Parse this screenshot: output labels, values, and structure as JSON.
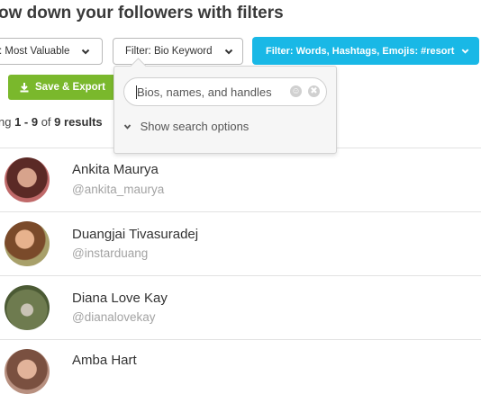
{
  "page": {
    "heading": "ow down your followers with filters"
  },
  "toolbar": {
    "sort_label": ": Most Valuable",
    "bio_filter_label": "Filter: Bio Keyword",
    "words_filter_label": "Filter: Words, Hashtags, Emojis: #resort",
    "save_label": "Save & Export"
  },
  "results": {
    "prefix": "ng ",
    "range": "1 - 9",
    "of": " of ",
    "total": "9 results"
  },
  "popup": {
    "search_placeholder": "Bios, names, and handles",
    "options_label": "Show search options"
  },
  "users": [
    {
      "name": "Ankita Maurya",
      "handle": "@ankita_maurya"
    },
    {
      "name": "Duangjai Tivasuradej",
      "handle": "@instarduang"
    },
    {
      "name": "Diana Love Kay",
      "handle": "@dianalovekay"
    },
    {
      "name": "Amba Hart",
      "handle": ""
    }
  ],
  "colors": {
    "accent_blue": "#19b8e6",
    "accent_green": "#7ab82c",
    "muted_text": "#a3a3a3"
  },
  "icons": [
    "chevron-down-icon",
    "download-icon",
    "emoji-icon",
    "clear-icon"
  ]
}
